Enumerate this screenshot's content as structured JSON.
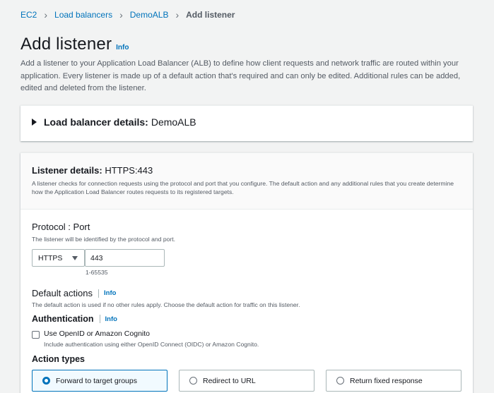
{
  "breadcrumb": {
    "items": [
      "EC2",
      "Load balancers",
      "DemoALB"
    ],
    "current": "Add listener"
  },
  "header": {
    "title": "Add listener",
    "info": "Info",
    "description": "Add a listener to your Application Load Balancer (ALB) to define how client requests and network traffic are routed within your application. Every listener is made up of a default action that's required and can only be edited. Additional rules can be added, edited and deleted from the listener."
  },
  "lb_panel": {
    "label": "Load balancer details:",
    "value": "DemoALB"
  },
  "listener_panel": {
    "label": "Listener details:",
    "value": "HTTPS:443",
    "description": "A listener checks for connection requests using the protocol and port that you configure. The default action and any additional rules that you create determine how the Application Load Balancer routes requests to its registered targets."
  },
  "protocol_port": {
    "label": "Protocol : Port",
    "description": "The listener will be identified by the protocol and port.",
    "protocol_selected": "HTTPS",
    "port_value": "443",
    "port_hint": "1-65535"
  },
  "default_actions": {
    "label": "Default actions",
    "info": "Info",
    "description": "The default action is used if no other rules apply. Choose the default action for traffic on this listener."
  },
  "authentication": {
    "label": "Authentication",
    "info": "Info",
    "checkbox_label": "Use OpenID or Amazon Cognito",
    "checkbox_description": "Include authentication using either OpenID Connect (OIDC) or Amazon Cognito."
  },
  "action_types": {
    "label": "Action types",
    "options": [
      "Forward to target groups",
      "Redirect to URL",
      "Return fixed response"
    ],
    "selected": "Forward to target groups"
  },
  "colors": {
    "link": "#0073bb",
    "background": "#f2f3f3",
    "text": "#16191f",
    "secondary_text": "#545b64"
  }
}
